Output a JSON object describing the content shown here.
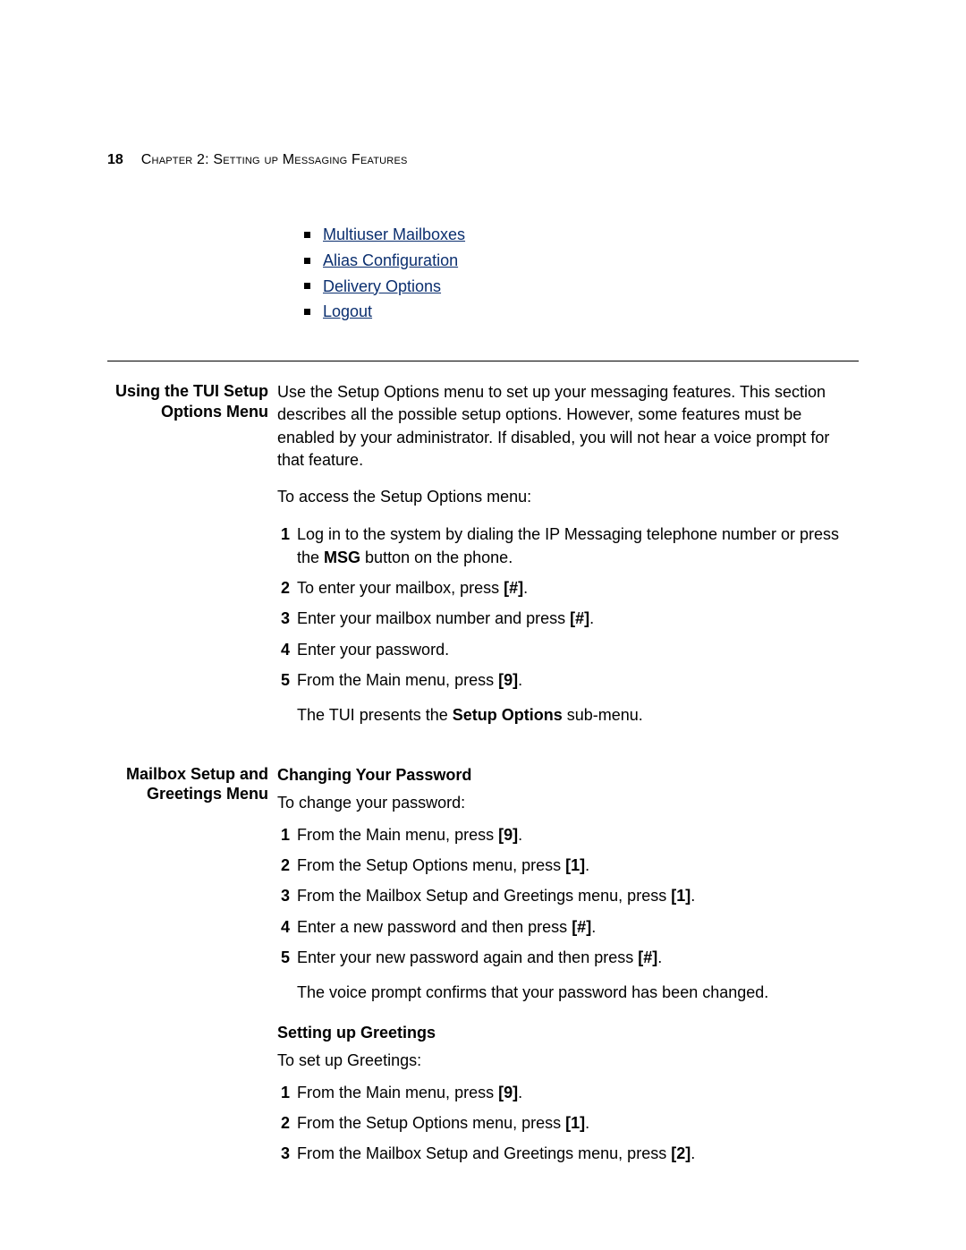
{
  "header": {
    "page_number": "18",
    "chapter_title": "Chapter 2: Setting up Messaging Features"
  },
  "links": [
    "Multiuser Mailboxes",
    "Alias Configuration",
    "Delivery Options",
    "Logout"
  ],
  "section1": {
    "heading_l1": "Using the TUI Setup",
    "heading_l2": "Options Menu",
    "para1": "Use the Setup Options menu to set up your messaging features. This section describes all the possible setup options. However, some features must be enabled by your administrator. If disabled, you will not hear a voice prompt for that feature.",
    "para2": "To access the Setup Options menu:",
    "steps": {
      "s1a": "Log in to the system by dialing the IP Messaging telephone number or press the ",
      "s1b": "MSG",
      "s1c": " button on the phone.",
      "s2a": "To enter your mailbox, press ",
      "s2b": "[#]",
      "s2c": ".",
      "s3a": "Enter your mailbox number and press ",
      "s3b": "[#]",
      "s3c": ".",
      "s4": "Enter your password.",
      "s5a": "From the Main menu, press ",
      "s5b": "[9]",
      "s5c": "."
    },
    "after_a": "The TUI presents the ",
    "after_b": "Setup Options",
    "after_c": " sub-menu."
  },
  "section2": {
    "heading_l1": "Mailbox Setup and",
    "heading_l2": "Greetings Menu",
    "sub1_title": "Changing Your Password",
    "sub1_intro": "To change your password:",
    "sub1_steps": {
      "s1a": "From the Main menu, press ",
      "s1b": "[9]",
      "s1c": ".",
      "s2a": "From the Setup Options menu, press ",
      "s2b": "[1]",
      "s2c": ".",
      "s3a": "From the Mailbox Setup and Greetings menu, press ",
      "s3b": "[1]",
      "s3c": ".",
      "s4a": "Enter a new password and then press ",
      "s4b": "[#]",
      "s4c": ".",
      "s5a": "Enter your new password again and then press ",
      "s5b": "[#]",
      "s5c": "."
    },
    "sub1_after": "The voice prompt confirms that your password has been changed.",
    "sub2_title": "Setting up Greetings",
    "sub2_intro": "To set up Greetings:",
    "sub2_steps": {
      "s1a": "From the Main menu, press ",
      "s1b": "[9]",
      "s1c": ".",
      "s2a": "From the Setup Options menu, press ",
      "s2b": "[1]",
      "s2c": ".",
      "s3a": "From the Mailbox Setup and Greetings menu, press ",
      "s3b": "[2]",
      "s3c": "."
    }
  }
}
